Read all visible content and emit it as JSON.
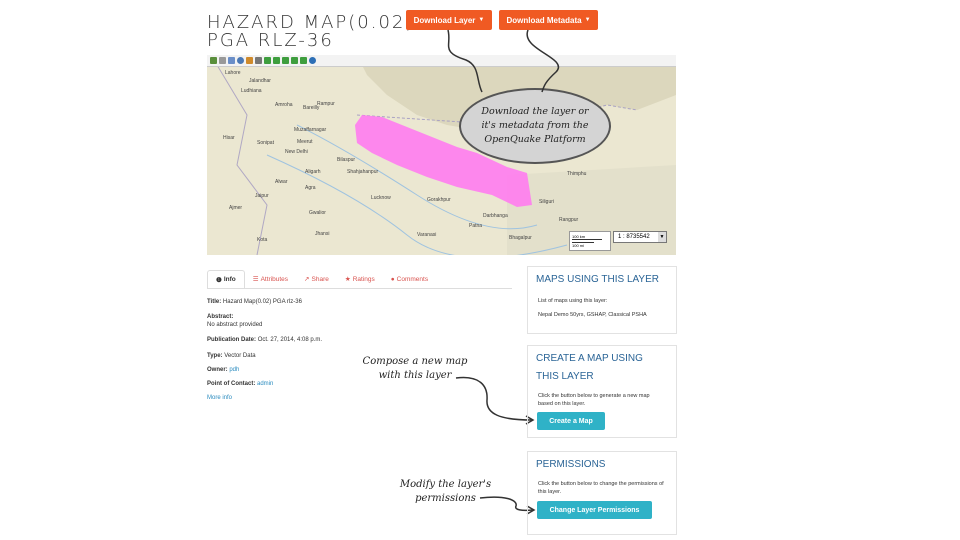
{
  "header": {
    "title_line1": "HAZARD MAP(0.02)",
    "title_line2": "PGA RLZ-36"
  },
  "buttons": {
    "download_layer": "Download Layer",
    "download_metadata": "Download Metadata"
  },
  "callouts": {
    "download": "Download the layer or it's metadata from the OpenQuake Platform",
    "compose_l1": "Compose a new map",
    "compose_l2": "with this layer",
    "modify_l1": "Modify the layer's",
    "modify_l2": "permissions"
  },
  "map": {
    "cities": [
      "Lahore",
      "Jalandhar",
      "Ludhiana",
      "Amroha",
      "Bareilly",
      "Muzaffarnagar",
      "Meerut",
      "New Delhi",
      "Sonipat",
      "Hisar",
      "Jaipur",
      "Aligarh",
      "Agra",
      "Gwalior",
      "Jhansi",
      "Kota",
      "Ajmer",
      "Lucknow",
      "Shahjahanpur",
      "Gorakhpur",
      "Varanasi",
      "Patna",
      "Bhagalpur",
      "Darbhanga",
      "Siliguri",
      "Rangpur",
      "Thimphu",
      "Bilaspur",
      "Alwar",
      "Rampur"
    ],
    "scale_km": "100 km",
    "scale_mi": "100 mi",
    "scale_ratio": "1 : 8735542",
    "pink_color": "#ff7cf0"
  },
  "tabs": [
    "Info",
    "Attributes",
    "Share",
    "Ratings",
    "Comments"
  ],
  "info": {
    "title_label": "Title:",
    "title_value": "Hazard Map(0.02) PGA rlz-36",
    "abstract_label": "Abstract:",
    "abstract_value": "No abstract provided",
    "pubdate_label": "Publication Date:",
    "pubdate_value": "Oct. 27, 2014, 4:08 p.m.",
    "type_label": "Type:",
    "type_value": "Vector Data",
    "owner_label": "Owner:",
    "owner_value": "pdh",
    "poc_label": "Point of Contact:",
    "poc_value": "admin",
    "more_info": "More info"
  },
  "panels": {
    "maps_title": "MAPS USING THIS LAYER",
    "maps_body": "List of maps using this layer:",
    "maps_link": "Nepal Demo 50yrs, GSHAP, Classical PSHA",
    "create_title": "CREATE A MAP USING THIS LAYER",
    "create_body": "Click the button below to generate a new map based on this layer.",
    "create_button": "Create a Map",
    "perm_title": "PERMISSIONS",
    "perm_body": "Click the button below to change the permissions of this layer.",
    "perm_button": "Change Layer Permissions"
  }
}
